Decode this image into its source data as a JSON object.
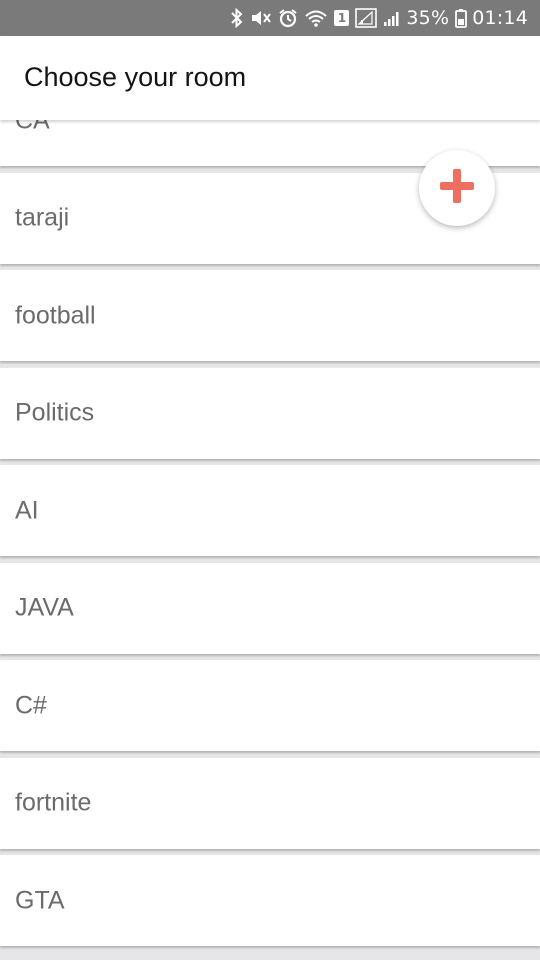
{
  "status_bar": {
    "sim_slot": "1",
    "battery_percent": "35%",
    "time": "01:14",
    "icons": [
      "bluetooth-icon",
      "mute-icon",
      "alarm-icon",
      "wifi-icon",
      "sim-icon",
      "signal-icon",
      "signal-weak-icon",
      "battery-icon"
    ]
  },
  "app_bar": {
    "title": "Choose your room"
  },
  "rooms": [
    {
      "name": "CA"
    },
    {
      "name": "taraji"
    },
    {
      "name": "football"
    },
    {
      "name": "Politics"
    },
    {
      "name": "AI"
    },
    {
      "name": "JAVA"
    },
    {
      "name": "C#"
    },
    {
      "name": "fortnite"
    },
    {
      "name": "GTA"
    }
  ],
  "fab": {
    "icon": "plus-icon",
    "icon_color": "#ee6e60"
  },
  "colors": {
    "status_bar": "#7a7a7a",
    "app_bar": "#ffffff",
    "list_background": "#e6e6e9",
    "item_text": "#6b6b6b"
  }
}
